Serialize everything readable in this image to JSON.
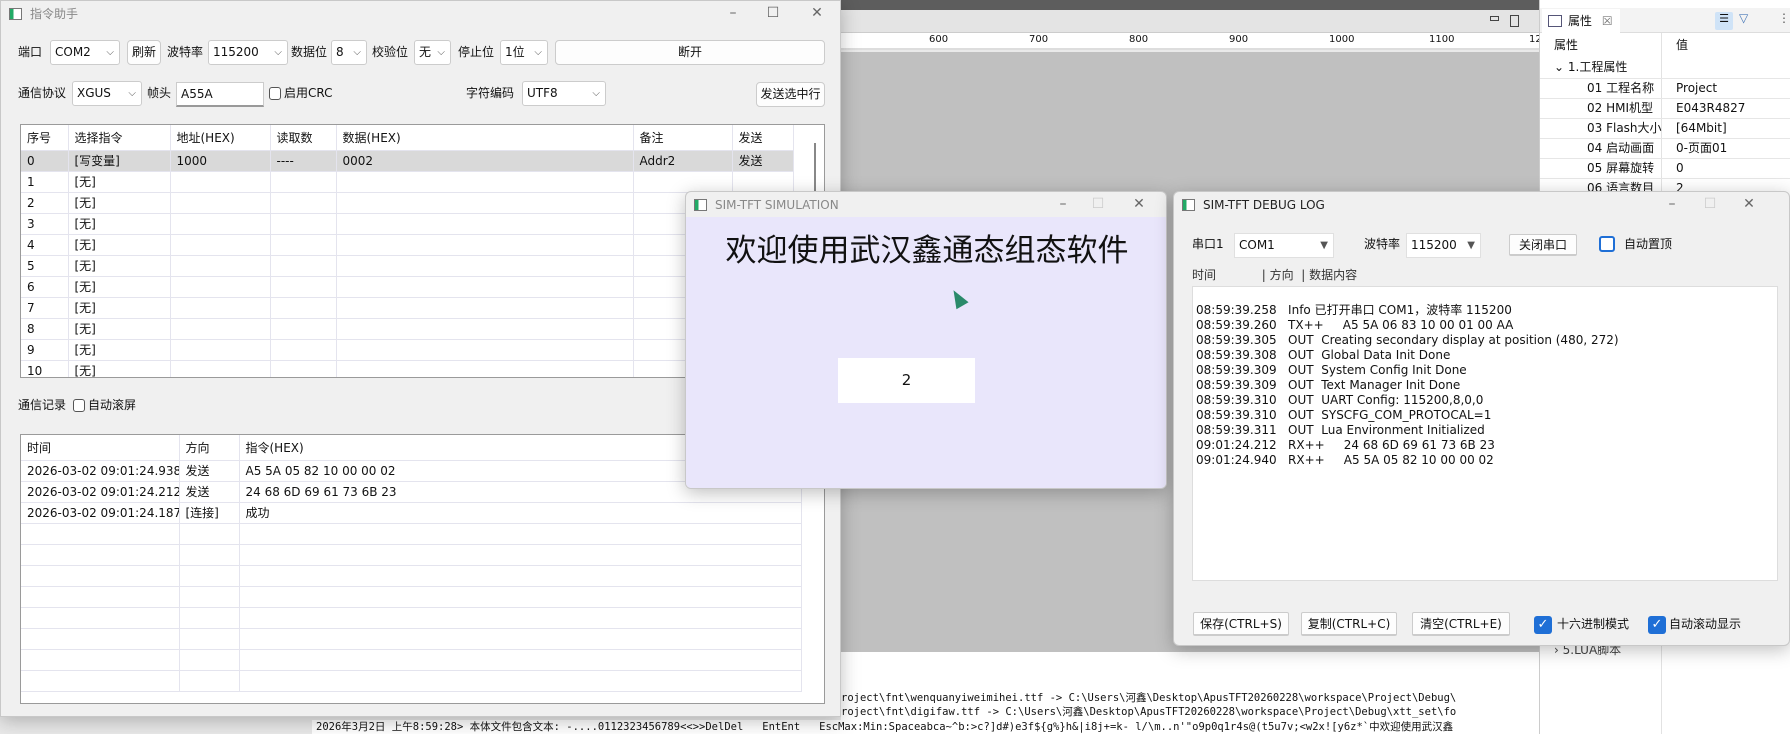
{
  "ide": {
    "ruler_ticks": [
      "600",
      "700",
      "800",
      "900",
      "1000",
      "1100",
      "12"
    ],
    "console_lines": [
      "roject\\fnt\\wenquanyiweimihei.ttf -> C:\\Users\\河鑫\\Desktop\\ApusTFT20260228\\workspace\\Project\\Debug\\",
      "roject\\fnt\\digifaw.ttf -> C:\\Users\\河鑫\\Desktop\\ApusTFT20260228\\workspace\\Project\\Debug\\xtt_set\\fo"
    ],
    "status_line": "2026年3月2日 上午8:59:28> 本体文件包含文本: -....0112323456789<<>>DelDel   EntEnt   EscMax:Min:Spaceabca~^b:>c?]d#)e3f${g%}h&|i8j+=k- l/\\m..n'\"o9p0q1r4s@(t5u7v;<w2x![y6z*`中欢迎使用武汉鑫"
  },
  "props": {
    "tab": "属性",
    "col_prop": "属性",
    "col_val": "值",
    "group": "1.工程属性",
    "rows": [
      {
        "k": "01 工程名称",
        "v": "Project"
      },
      {
        "k": "02 HMI机型",
        "v": "E043R4827"
      },
      {
        "k": "03 Flash大小",
        "v": "[64Mbit]"
      },
      {
        "k": "04 启动画面",
        "v": "0-页面01"
      },
      {
        "k": "05 屏幕旋转",
        "v": "0"
      },
      {
        "k": "06 语言数目",
        "v": "2"
      }
    ],
    "group5": "5.LUA脚本"
  },
  "assistant": {
    "title": "指令助手",
    "port_label": "端口",
    "port": "COM2",
    "refresh": "刷新",
    "baud_label": "波特率",
    "baud": "115200",
    "databits_label": "数据位",
    "databits": "8",
    "parity_label": "校验位",
    "parity": "无",
    "stop_label": "停止位",
    "stop": "1位",
    "disconnect": "断开",
    "protocol_label": "通信协议",
    "protocol": "XGUS",
    "header_label": "帧头",
    "header": "A55A",
    "crc_label": "启用CRC",
    "encoding_label": "字符编码",
    "encoding": "UTF8",
    "send_selected": "发送选中行",
    "cmd_columns": [
      "序号",
      "选择指令",
      "地址(HEX)",
      "读取数",
      "数据(HEX)",
      "备注",
      "发送"
    ],
    "cmd_rows": [
      [
        "0",
        "[写变量]",
        "1000",
        "----",
        "0002",
        "Addr2",
        "发送"
      ],
      [
        "1",
        "[无]",
        "",
        "",
        "",
        "",
        ""
      ],
      [
        "2",
        "[无]",
        "",
        "",
        "",
        "",
        ""
      ],
      [
        "3",
        "[无]",
        "",
        "",
        "",
        "",
        ""
      ],
      [
        "4",
        "[无]",
        "",
        "",
        "",
        "",
        ""
      ],
      [
        "5",
        "[无]",
        "",
        "",
        "",
        "",
        ""
      ],
      [
        "6",
        "[无]",
        "",
        "",
        "",
        "",
        ""
      ],
      [
        "7",
        "[无]",
        "",
        "",
        "",
        "",
        ""
      ],
      [
        "8",
        "[无]",
        "",
        "",
        "",
        "",
        ""
      ],
      [
        "9",
        "[无]",
        "",
        "",
        "",
        "",
        ""
      ],
      [
        "10",
        "[无]",
        "",
        "",
        "",
        "",
        ""
      ]
    ],
    "log_label": "通信记录",
    "autoscroll_label": "自动滚屏",
    "log_columns": [
      "时间",
      "方向",
      "指令(HEX)"
    ],
    "log_rows": [
      [
        "2026-03-02 09:01:24.938",
        "发送",
        "A5 5A 05 82 10 00 00 02"
      ],
      [
        "2026-03-02 09:01:24.212",
        "发送",
        "24 68 6D 69 61 73 6B 23"
      ],
      [
        "2026-03-02 09:01:24.187",
        "[连接]",
        "成功"
      ]
    ]
  },
  "sim": {
    "title": "SIM-TFT SIMULATION",
    "heading": "欢迎使用武汉鑫通态组态软件",
    "value": "2",
    "bg": "#e9e6fb"
  },
  "debug": {
    "title": "SIM-TFT DEBUG LOG",
    "port_label": "串口1",
    "port": "COM1",
    "baud_label": "波特率",
    "baud": "115200",
    "close_port": "关闭串口",
    "topmost_label": "自动置顶",
    "log_header": "时间            | 方向  | 数据内容",
    "lines": [
      "08:59:39.258   Info 已打开串口 COM1，波特率 115200",
      "08:59:39.260   TX++     A5 5A 06 83 10 00 01 00 AA",
      "08:59:39.305   OUT  Creating secondary display at position (480, 272)",
      "08:59:39.308   OUT  Global Data Init Done",
      "08:59:39.309   OUT  System Config Init Done",
      "08:59:39.309   OUT  Text Manager Init Done",
      "08:59:39.310   OUT  UART Config: 115200,8,0,0",
      "08:59:39.310   OUT  SYSCFG_COM_PROTOCAL=1",
      "08:59:39.311   OUT  Lua Environment Initialized",
      "09:01:24.212   RX++     24 68 6D 69 61 73 6B 23",
      "09:01:24.940   RX++     A5 5A 05 82 10 00 00 02"
    ],
    "save": "保存(CTRL+S)",
    "copy": "复制(CTRL+C)",
    "clear": "清空(CTRL+E)",
    "hex_label": "十六进制模式",
    "autoscroll_label": "自动滚动显示",
    "accent": "#1f6fd6"
  }
}
